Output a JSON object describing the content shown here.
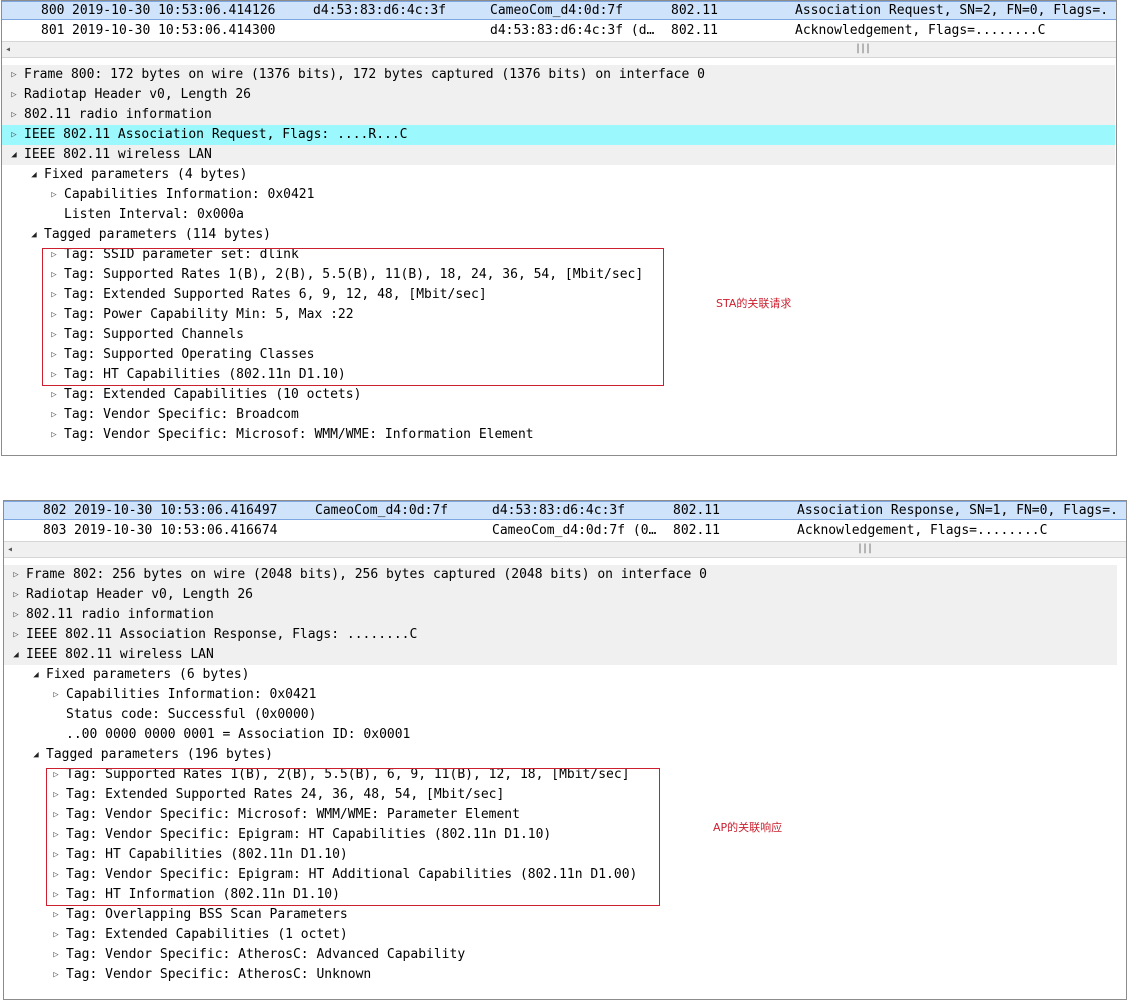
{
  "panel1": {
    "packets": [
      {
        "no": "800",
        "time": "2019-10-30 10:53:06.414126",
        "src": "d4:53:83:d6:4c:3f",
        "dst": "CameoCom_d4:0d:7f",
        "proto": "802.11",
        "info": "Association Request, SN=2, FN=0, Flags=."
      },
      {
        "no": "801",
        "time": "2019-10-30 10:53:06.414300",
        "src": "",
        "dst": "d4:53:83:d6:4c:3f (d…",
        "proto": "802.11",
        "info": "Acknowledgement, Flags=........C"
      }
    ],
    "tree": [
      {
        "text": "Frame 800: 172 bytes on wire (1376 bits), 172 bytes captured (1376 bits) on interface 0",
        "level": 0,
        "state": "collapsed"
      },
      {
        "text": "Radiotap Header v0, Length 26",
        "level": 0,
        "state": "collapsed"
      },
      {
        "text": "802.11 radio information",
        "level": 0,
        "state": "collapsed"
      },
      {
        "text": "IEEE 802.11 Association Request, Flags: ....R...C",
        "level": 0,
        "state": "collapsed"
      },
      {
        "text": "IEEE 802.11 wireless LAN",
        "level": 0,
        "state": "expanded"
      },
      {
        "text": "Fixed parameters (4 bytes)",
        "level": 1,
        "state": "expanded"
      },
      {
        "text": "Capabilities Information: 0x0421",
        "level": 2,
        "state": "collapsed"
      },
      {
        "text": "Listen Interval: 0x000a",
        "level": 2,
        "state": "leaf"
      },
      {
        "text": "Tagged parameters (114 bytes)",
        "level": 1,
        "state": "expanded"
      },
      {
        "text": "Tag: SSID parameter set: dlink",
        "level": 2,
        "state": "collapsed"
      },
      {
        "text": "Tag: Supported Rates 1(B), 2(B), 5.5(B), 11(B), 18, 24, 36, 54, [Mbit/sec]",
        "level": 2,
        "state": "collapsed"
      },
      {
        "text": "Tag: Extended Supported Rates 6, 9, 12, 48, [Mbit/sec]",
        "level": 2,
        "state": "collapsed"
      },
      {
        "text": "Tag: Power Capability Min: 5, Max :22",
        "level": 2,
        "state": "collapsed"
      },
      {
        "text": "Tag: Supported Channels",
        "level": 2,
        "state": "collapsed"
      },
      {
        "text": "Tag: Supported Operating Classes",
        "level": 2,
        "state": "collapsed"
      },
      {
        "text": "Tag: HT Capabilities (802.11n D1.10)",
        "level": 2,
        "state": "collapsed"
      },
      {
        "text": "Tag: Extended Capabilities (10 octets)",
        "level": 2,
        "state": "collapsed"
      },
      {
        "text": "Tag: Vendor Specific: Broadcom",
        "level": 2,
        "state": "collapsed"
      },
      {
        "text": "Tag: Vendor Specific: Microsof: WMM/WME: Information Element",
        "level": 2,
        "state": "collapsed"
      }
    ],
    "annotation": "STA的关联请求"
  },
  "panel2": {
    "packets": [
      {
        "no": "802",
        "time": "2019-10-30 10:53:06.416497",
        "src": "CameoCom_d4:0d:7f",
        "dst": "d4:53:83:d6:4c:3f",
        "proto": "802.11",
        "info": "Association Response, SN=1, FN=0, Flags=."
      },
      {
        "no": "803",
        "time": "2019-10-30 10:53:06.416674",
        "src": "",
        "dst": "CameoCom_d4:0d:7f (0…",
        "proto": "802.11",
        "info": "Acknowledgement, Flags=........C"
      }
    ],
    "tree": [
      {
        "text": "Frame 802: 256 bytes on wire (2048 bits), 256 bytes captured (2048 bits) on interface 0",
        "level": 0,
        "state": "collapsed"
      },
      {
        "text": "Radiotap Header v0, Length 26",
        "level": 0,
        "state": "collapsed"
      },
      {
        "text": "802.11 radio information",
        "level": 0,
        "state": "collapsed"
      },
      {
        "text": "IEEE 802.11 Association Response, Flags: ........C",
        "level": 0,
        "state": "collapsed"
      },
      {
        "text": "IEEE 802.11 wireless LAN",
        "level": 0,
        "state": "expanded"
      },
      {
        "text": "Fixed parameters (6 bytes)",
        "level": 1,
        "state": "expanded"
      },
      {
        "text": "Capabilities Information: 0x0421",
        "level": 2,
        "state": "collapsed"
      },
      {
        "text": "Status code: Successful (0x0000)",
        "level": 2,
        "state": "leaf"
      },
      {
        "text": "..00 0000 0000 0001 = Association ID: 0x0001",
        "level": 2,
        "state": "leaf"
      },
      {
        "text": "Tagged parameters (196 bytes)",
        "level": 1,
        "state": "expanded"
      },
      {
        "text": "Tag: Supported Rates 1(B), 2(B), 5.5(B), 6, 9, 11(B), 12, 18, [Mbit/sec]",
        "level": 2,
        "state": "collapsed"
      },
      {
        "text": "Tag: Extended Supported Rates 24, 36, 48, 54, [Mbit/sec]",
        "level": 2,
        "state": "collapsed"
      },
      {
        "text": "Tag: Vendor Specific: Microsof: WMM/WME: Parameter Element",
        "level": 2,
        "state": "collapsed"
      },
      {
        "text": "Tag: Vendor Specific: Epigram: HT Capabilities (802.11n D1.10)",
        "level": 2,
        "state": "collapsed"
      },
      {
        "text": "Tag: HT Capabilities (802.11n D1.10)",
        "level": 2,
        "state": "collapsed"
      },
      {
        "text": "Tag: Vendor Specific: Epigram: HT Additional Capabilities (802.11n D1.00)",
        "level": 2,
        "state": "collapsed"
      },
      {
        "text": "Tag: HT Information (802.11n D1.10)",
        "level": 2,
        "state": "collapsed"
      },
      {
        "text": "Tag: Overlapping BSS Scan Parameters",
        "level": 2,
        "state": "collapsed"
      },
      {
        "text": "Tag: Extended Capabilities (1 octet)",
        "level": 2,
        "state": "collapsed"
      },
      {
        "text": "Tag: Vendor Specific: AtherosC: Advanced Capability",
        "level": 2,
        "state": "collapsed"
      },
      {
        "text": "Tag: Vendor Specific: AtherosC: Unknown",
        "level": 2,
        "state": "collapsed"
      }
    ],
    "annotation": "AP的关联响应"
  },
  "scrollbar": {
    "left_arrow": "◂",
    "grip": "|||"
  },
  "icons": {
    "collapsed": "▷",
    "expanded": "◢"
  },
  "colors": {
    "selected_row": "#cfe3fb",
    "highlight_row": "#9bf8fc",
    "annotation": "#cc2030",
    "shaded_row": "#f0f0f0"
  }
}
